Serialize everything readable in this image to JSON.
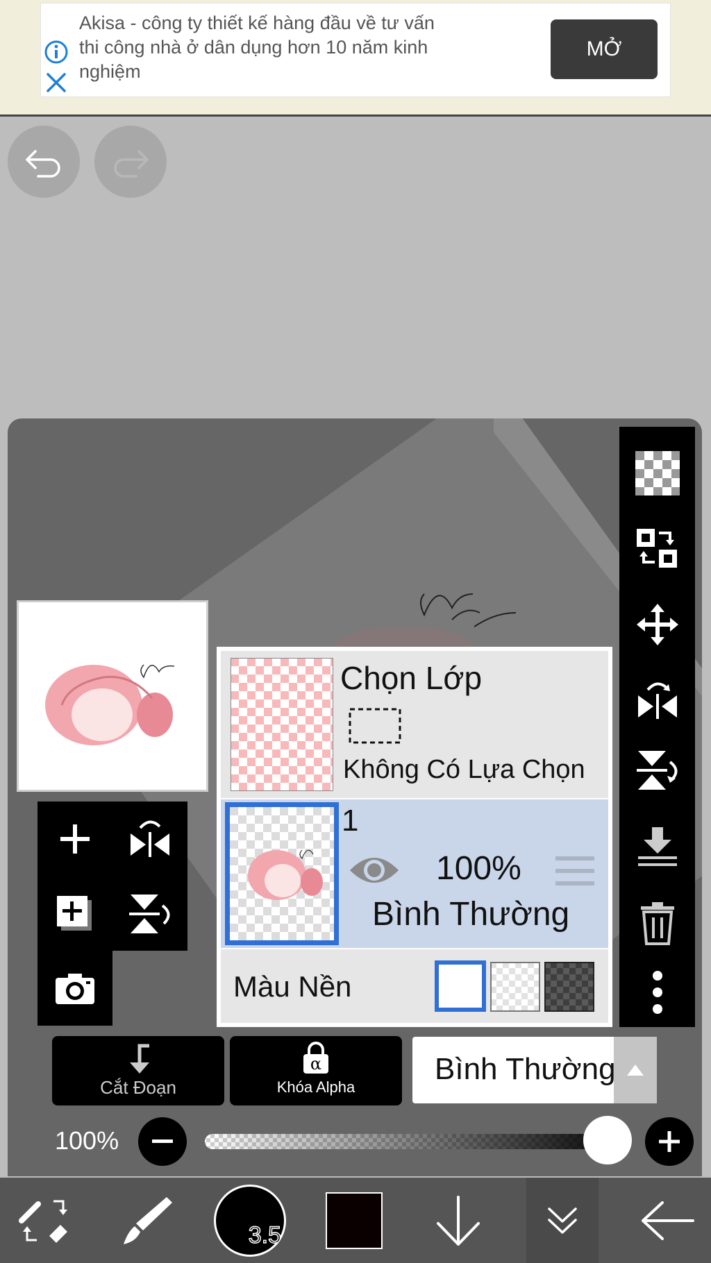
{
  "ad": {
    "text": "Akisa - công ty thiết kế hàng đầu về tư vấn\nthi công nhà ở dân dụng hơn 10 năm kinh\nnghiệm",
    "open_label": "MỞ",
    "info_icon": "info-icon",
    "close_icon": "close-icon"
  },
  "history": {
    "undo_icon": "undo-icon",
    "redo_icon": "redo-icon"
  },
  "canvas": {
    "signature_text": "Chi ThDy 2022"
  },
  "layers": {
    "selection_layer": {
      "title": "Chọn Lớp",
      "subtitle": "Không Có Lựa Chọn"
    },
    "layer_1": {
      "name": "1",
      "opacity": "100%",
      "blend_mode": "Bình Thường"
    },
    "background": {
      "label": "Màu Nền",
      "options": [
        "white",
        "transparent",
        "dark-checker"
      ],
      "selected": "white"
    }
  },
  "sidebar_tools": [
    "transparency-icon",
    "swap-layers-icon",
    "move-icon",
    "flip-horizontal-icon",
    "flip-vertical-icon",
    "merge-down-icon",
    "trash-icon",
    "more-icon"
  ],
  "controls": {
    "clipping_label": "Cắt Đoạn",
    "alpha_lock_label": "Khóa Alpha",
    "blend_mode": "Bình Thường",
    "opacity_label": "100%",
    "opacity_value": 1.0
  },
  "toolbar": {
    "brush_size": "3.5",
    "color": "#0a0000"
  },
  "colors": {
    "accent": "#2f6fd6",
    "panel": "#666666",
    "selected_row": "#c9d6ea"
  }
}
